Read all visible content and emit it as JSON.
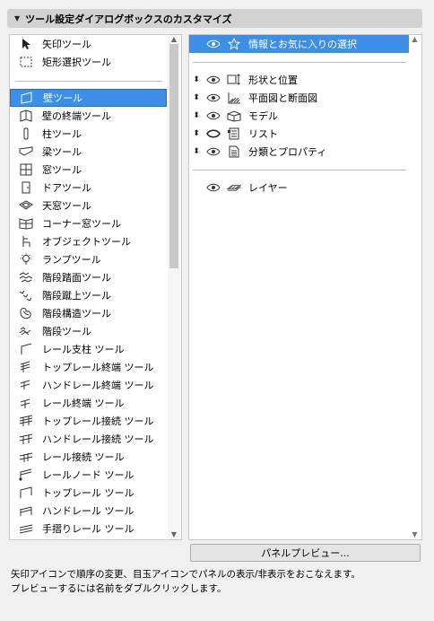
{
  "header": {
    "title": "ツール設定ダイアログボックスのカスタマイズ"
  },
  "left_list": {
    "top_items": [
      {
        "label": "矢印ツール",
        "icon": "arrow-icon"
      },
      {
        "label": "矩形選択ツール",
        "icon": "marquee-icon"
      }
    ],
    "items": [
      {
        "label": "壁ツール",
        "icon": "wall-icon",
        "selected": true
      },
      {
        "label": "壁の終端ツール",
        "icon": "wall-end-icon"
      },
      {
        "label": "柱ツール",
        "icon": "column-icon"
      },
      {
        "label": "梁ツール",
        "icon": "beam-icon"
      },
      {
        "label": "窓ツール",
        "icon": "window-icon"
      },
      {
        "label": "ドアツール",
        "icon": "door-icon"
      },
      {
        "label": "天窓ツール",
        "icon": "skylight-icon"
      },
      {
        "label": "コーナー窓ツール",
        "icon": "corner-window-icon"
      },
      {
        "label": "オブジェクトツール",
        "icon": "object-icon"
      },
      {
        "label": "ランプツール",
        "icon": "lamp-icon"
      },
      {
        "label": "階段踏面ツール",
        "icon": "stair-tread-icon"
      },
      {
        "label": "階段蹴上ツール",
        "icon": "stair-riser-icon"
      },
      {
        "label": "階段構造ツール",
        "icon": "stair-structure-icon"
      },
      {
        "label": "階段ツール",
        "icon": "stair-icon"
      },
      {
        "label": "レール支柱 ツール",
        "icon": "rail-post-icon"
      },
      {
        "label": "トップレール終端 ツール",
        "icon": "toprail-end-icon"
      },
      {
        "label": "ハンドレール終端 ツール",
        "icon": "handrail-end-icon"
      },
      {
        "label": "レール終端 ツール",
        "icon": "rail-end-icon"
      },
      {
        "label": "トップレール接続 ツール",
        "icon": "toprail-connection-icon"
      },
      {
        "label": "ハンドレール接続 ツール",
        "icon": "handrail-connection-icon"
      },
      {
        "label": "レール接続 ツール",
        "icon": "rail-connection-icon"
      },
      {
        "label": "レールノード ツール",
        "icon": "rail-node-icon"
      },
      {
        "label": "トップレール ツール",
        "icon": "toprail-icon"
      },
      {
        "label": "ハンドレール ツール",
        "icon": "handrail-icon"
      },
      {
        "label": "手摺りレール ツール",
        "icon": "guard-rail-icon"
      }
    ]
  },
  "right_list": {
    "favorites": {
      "label": "情報とお気に入りの選択",
      "icon": "star-icon",
      "selected": true
    },
    "panels": [
      {
        "label": "形状と位置",
        "icon": "geometry-icon",
        "visible": true
      },
      {
        "label": "平面図と断面図",
        "icon": "floorplan-section-icon",
        "visible": true
      },
      {
        "label": "モデル",
        "icon": "model-icon",
        "visible": true
      },
      {
        "label": "リスト",
        "icon": "list-icon",
        "visible": false
      },
      {
        "label": "分類とプロパティ",
        "icon": "classification-icon",
        "visible": true
      }
    ],
    "layer": {
      "label": "レイヤー",
      "icon": "layer-icon"
    }
  },
  "buttons": {
    "preview": "パネルプレビュー..."
  },
  "help": {
    "line1": "矢印アイコンで順序の変更、目玉アイコンでパネルの表示/非表示をおこなえます。",
    "line2": "プレビューするには名前をダブルクリックします。"
  },
  "colors": {
    "selection": "#3d8ee6",
    "header_bg": "#d2d2d2",
    "panel_bg": "#ffffff",
    "window_bg": "#f0f0f0"
  }
}
